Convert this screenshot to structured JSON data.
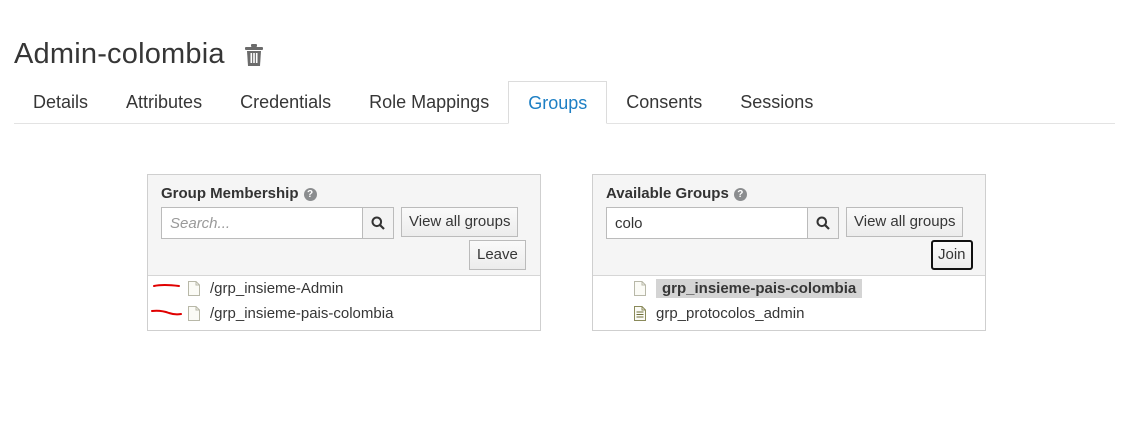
{
  "header": {
    "title": "Admin-colombia",
    "delete_icon": "trash-icon"
  },
  "tabs": [
    {
      "label": "Details",
      "active": false
    },
    {
      "label": "Attributes",
      "active": false
    },
    {
      "label": "Credentials",
      "active": false
    },
    {
      "label": "Role Mappings",
      "active": false
    },
    {
      "label": "Groups",
      "active": true
    },
    {
      "label": "Consents",
      "active": false
    },
    {
      "label": "Sessions",
      "active": false
    }
  ],
  "membership": {
    "label": "Group Membership",
    "search_placeholder": "Search...",
    "search_value": "",
    "view_all_label": "View all groups",
    "leave_label": "Leave",
    "items": [
      {
        "label": "/grp_insieme-Admin",
        "icon": "file-icon"
      },
      {
        "label": "/grp_insieme-pais-colombia",
        "icon": "file-icon"
      }
    ]
  },
  "available": {
    "label": "Available Groups",
    "search_placeholder": "",
    "search_value": "colo",
    "view_all_label": "View all groups",
    "join_label": "Join",
    "items": [
      {
        "label": "grp_insieme-pais-colombia",
        "icon": "file-icon",
        "selected": true
      },
      {
        "label": "grp_protocolos_admin",
        "icon": "file-text-icon",
        "selected": false
      }
    ]
  },
  "colors": {
    "accent": "#1d7fc4",
    "annotation": "#e00000",
    "panel_header": "#f5f5f5"
  }
}
